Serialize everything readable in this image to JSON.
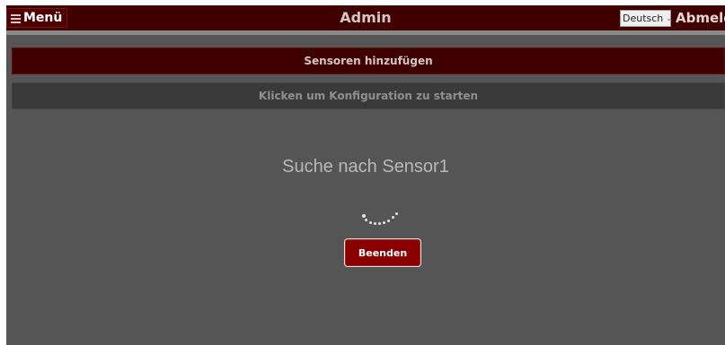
{
  "header": {
    "menu_label": "Menü",
    "title": "Admin",
    "language": "Deutsch",
    "logout_label": "Abmelde"
  },
  "main": {
    "add_sensors_label": "Sensoren hinzufügen",
    "start_config_label": "Klicken um Konfiguration zu starten",
    "search_status": "Suche nach Sensor1",
    "stop_button_label": "Beenden"
  },
  "icons": {
    "menu": "hamburger-icon",
    "language_dropdown": "chevron-down-icon",
    "loading": "spinner-icon"
  },
  "colors": {
    "header_bg": "#410000",
    "add_bar_bg": "#3f0000",
    "config_bar_bg": "#3a3a3a",
    "content_bg": "#555555",
    "stop_button_bg": "#8a0000"
  }
}
